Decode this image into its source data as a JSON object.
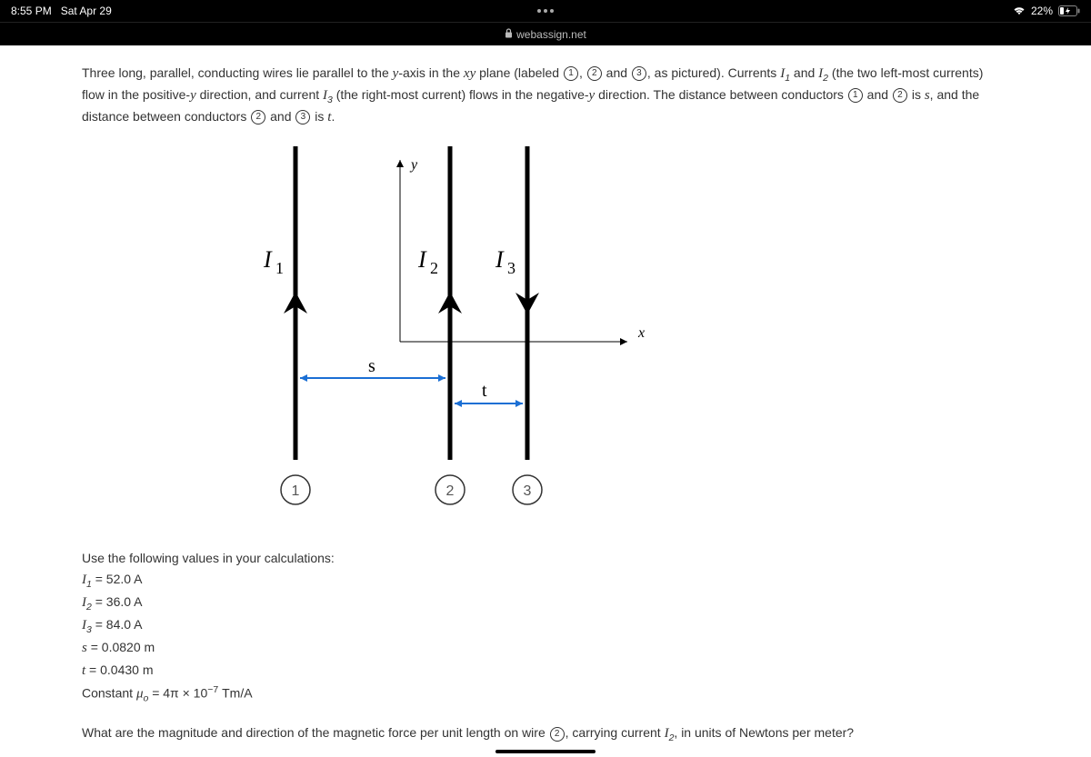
{
  "status": {
    "time": "8:55 PM",
    "date": "Sat Apr 29",
    "battery": "22%"
  },
  "url": "webassign.net",
  "problem": {
    "p1_a": "Three long, parallel, conducting wires lie parallel to the ",
    "p1_yaxis": "y",
    "p1_b": "-axis in the ",
    "p1_xy": "xy",
    "p1_c": " plane (labeled ",
    "c1": "1",
    "c2": "2",
    "c3": "3",
    "p1_d": ", as pictured). Currents ",
    "I1": "I",
    "p1_e": " and ",
    "p1_f": " (the two left-most currents) flow in the positive-",
    "p1_g": " direction, and current ",
    "p1_h": " (the right-most current) flows in the negative-",
    "p1_i": " direction. The distance between conductors ",
    "p1_j": " is ",
    "s": "s",
    "p1_k": ", and the distance between conductors ",
    "t": "t",
    "p1_l": "."
  },
  "diagram": {
    "y": "y",
    "x": "x",
    "I1": "I",
    "sub1": "1",
    "I2": "I",
    "sub2": "2",
    "I3": "I",
    "sub3": "3",
    "s": "s",
    "t": "t",
    "n1": "1",
    "n2": "2",
    "n3": "3"
  },
  "values": {
    "header": "Use the following values in your calculations:",
    "I1": " = 52.0 A",
    "I2": " = 36.0 A",
    "I3": " = 84.0 A",
    "s": " = 0.0820 m",
    "t": " = 0.0430 m",
    "mu_label": "Constant ",
    "mu_sym": "μ",
    "mu_sub": "o",
    "mu_val": " = 4π × 10",
    "mu_exp": "−7",
    "mu_unit": " Tm/A"
  },
  "question": {
    "a": "What are the magnitude and direction of the magnetic force per unit length on wire ",
    "b": ", carrying current ",
    "c": ", in units of Newtons per meter?"
  }
}
